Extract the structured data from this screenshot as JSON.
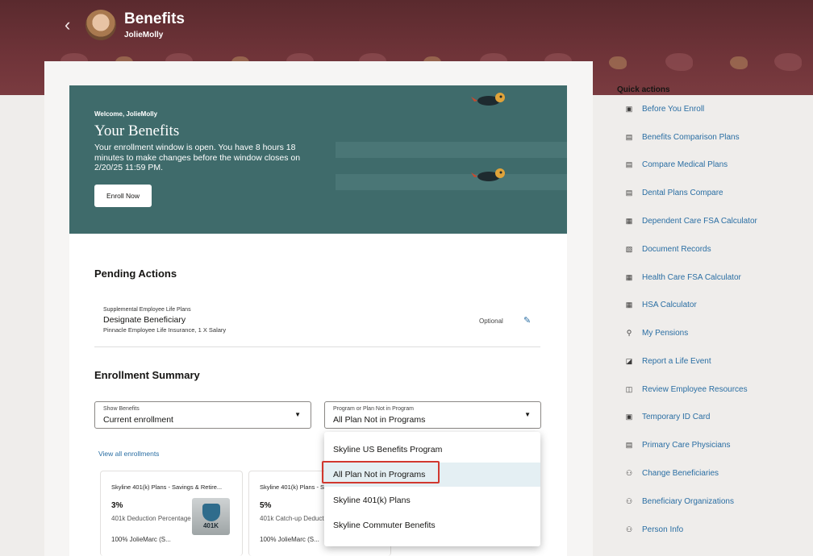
{
  "header": {
    "back_icon": "chevron-left-icon",
    "title": "Benefits",
    "user": "JolieMolly"
  },
  "banner": {
    "welcome": "Welcome, JolieMolly",
    "title": "Your Benefits",
    "message": "Your enrollment window is open. You have 8 hours 18 minutes to make changes before the window closes on 2/20/25 11:59 PM.",
    "button": "Enroll Now"
  },
  "pending_actions": {
    "heading": "Pending Actions",
    "item": {
      "category": "Supplemental Employee Life Plans",
      "title": "Designate Beneficiary",
      "subtitle": "Pinnacle Employee Life Insurance, 1 X Salary",
      "status": "Optional"
    }
  },
  "enrollment_summary": {
    "heading": "Enrollment Summary",
    "show_benefits": {
      "label": "Show Benefits",
      "value": "Current enrollment"
    },
    "program_filter": {
      "label": "Program or Plan Not in Program",
      "value": "All Plan Not in Programs"
    },
    "view_all": "View all enrollments",
    "tiles": [
      {
        "title": "Skyline 401(k) Plans - Savings & Retire...",
        "percent": "3%",
        "desc": "401k Deduction Percentage",
        "payee": "100% JolieMarc (S...",
        "badge": "401K"
      },
      {
        "title": "Skyline 401(k) Plans - S...",
        "percent": "5%",
        "desc": "401k Catch-up Deduction...",
        "payee": "100% JolieMarc (S..."
      }
    ]
  },
  "dropdown": {
    "options": [
      "Skyline US Benefits Program",
      "All Plan Not in Programs",
      "Skyline 401(k) Plans",
      "Skyline Commuter Benefits"
    ],
    "selected_index": 1
  },
  "quick_actions": {
    "title": "Quick actions",
    "items": [
      {
        "label": "Before You Enroll",
        "icon": "book-icon"
      },
      {
        "label": "Benefits Comparison Plans",
        "icon": "briefcase-icon"
      },
      {
        "label": "Compare Medical Plans",
        "icon": "briefcase-icon"
      },
      {
        "label": "Dental Plans Compare",
        "icon": "briefcase-icon"
      },
      {
        "label": "Dependent Care FSA Calculator",
        "icon": "calculator-icon"
      },
      {
        "label": "Document Records",
        "icon": "document-icon"
      },
      {
        "label": "Health Care FSA Calculator",
        "icon": "calculator-icon"
      },
      {
        "label": "HSA Calculator",
        "icon": "calculator-icon"
      },
      {
        "label": "My Pensions",
        "icon": "person-icon"
      },
      {
        "label": "Report a Life Event",
        "icon": "event-icon"
      },
      {
        "label": "Review Employee Resources",
        "icon": "resources-icon"
      },
      {
        "label": "Temporary ID Card",
        "icon": "id-card-icon"
      },
      {
        "label": "Primary Care Physicians",
        "icon": "briefcase-icon"
      },
      {
        "label": "Change Beneficiaries",
        "icon": "people-icon"
      },
      {
        "label": "Beneficiary Organizations",
        "icon": "people-icon"
      },
      {
        "label": "Person Info",
        "icon": "people-icon"
      }
    ]
  },
  "colors": {
    "header_bg": "#6e3338",
    "banner_bg": "#3f6b6b",
    "link": "#2a6ea3",
    "highlight": "#d1382f",
    "selected_option": "#e4eff3"
  }
}
